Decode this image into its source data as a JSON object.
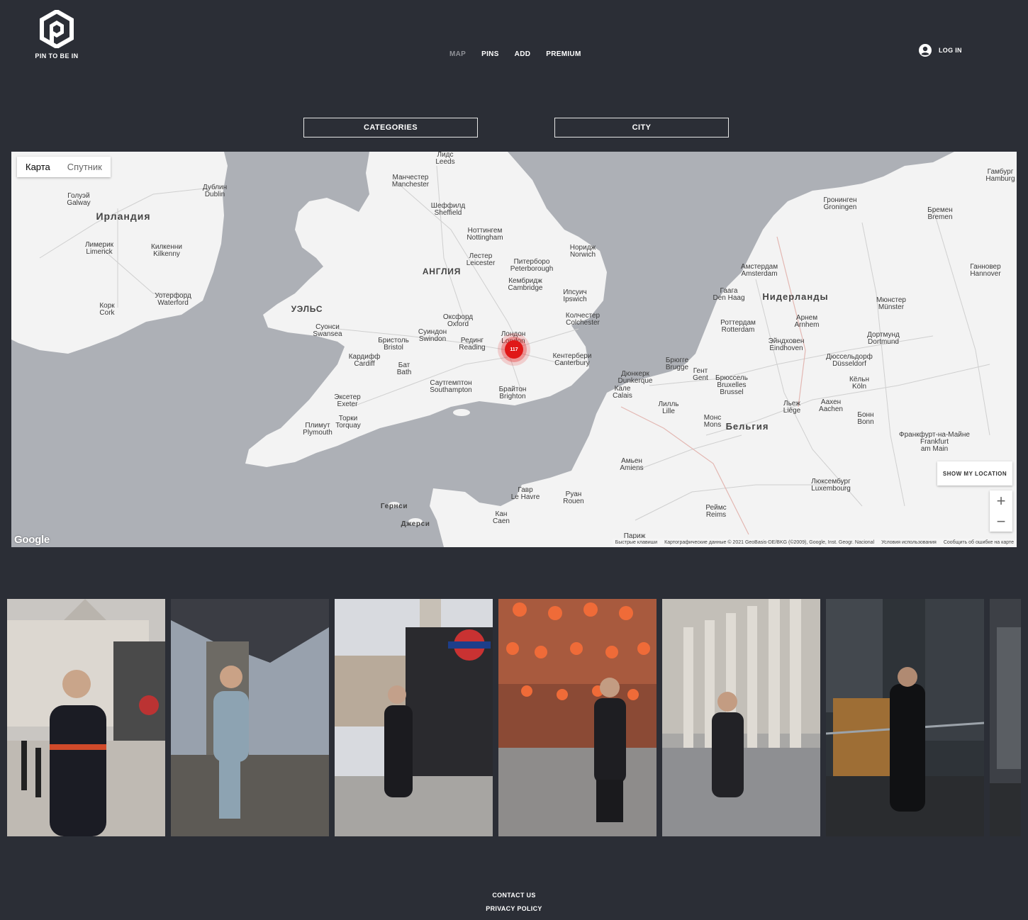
{
  "header": {
    "logo_text": "PIN TO BE IN",
    "nav": [
      "MAP",
      "PINS",
      "ADD",
      "PREMIUM"
    ],
    "login_label": "LOG IN"
  },
  "filters": {
    "categories_label": "CATEGORIES",
    "city_label": "CITY"
  },
  "map": {
    "type_map": "Карта",
    "type_satellite": "Спутник",
    "show_location": "SHOW MY LOCATION",
    "zoom_in": "+",
    "zoom_out": "−",
    "google_logo": "Google",
    "cluster_count": "117",
    "attribution": [
      "Быстрые клавиши",
      "Картографические данные © 2021 GeoBasis-DE/BKG (©2009), Google, Inst. Geogr. Nacional",
      "Условия использования",
      "Сообщить об ошибке на карте"
    ],
    "labels": {
      "ireland": "Ирландия",
      "england": "АНГЛИЯ",
      "wales": "УЭЛЬС",
      "netherlands": "Нидерланды",
      "belgium": "Бельгия",
      "guernsey": "Гернси",
      "jersey": "Джерси",
      "dublin": "Дублин\nDublin",
      "limerick": "Лимерик\nLimerick",
      "cork": "Корк\nCork",
      "galway": "Голуэй\nGalway",
      "kilkenny": "Килкенни\nKilkenny",
      "waterford": "Уотерфорд\nWaterford",
      "manchester": "Манчестер\nManchester",
      "leeds": "Лидс\nLeeds",
      "sheffield": "Шеффилд\nSheffield",
      "nottingham": "Ноттингем\nNottingham",
      "leicester": "Лестер\nLeicester",
      "peterborough": "Питерборо\nPeterborough",
      "cambridge": "Кембридж\nCambridge",
      "norwich": "Норидж\nNorwich",
      "ipswich": "Ипсуич\nIpswich",
      "colchester": "Колчестер\nColchester",
      "oxford": "Оксфорд\nOxford",
      "london": "Лондон\nLondon",
      "reading": "Рединг\nReading",
      "swindon": "Суиндон\nSwindon",
      "bristol": "Бристоль\nBristol",
      "cardiff": "Кардифф\nCardiff",
      "swansea": "Суонси\nSwansea",
      "bath": "Бат\nBath",
      "southampton": "Саутгемптон\nSouthampton",
      "brighton": "Брайтон\nBrighton",
      "exeter": "Эксетер\nExeter",
      "plymouth": "Плимут\nPlymouth",
      "torquay": "Торки\nTorquay",
      "canterbury": "Кентербери\nCanterbury",
      "amsterdam": "Амстердам\nAmsterdam",
      "den_haag": "Гаага\nDen Haag",
      "rotterdam": "Роттердам\nRotterdam",
      "brussels": "Брюссель\nBruxelles\nBrussel",
      "gent": "Гент\nGent",
      "brugge": "Брюгге\nBrugge",
      "lille": "Лилль\nLille",
      "dunkerque": "Дюнкерк\nDunkerque",
      "calais": "Кале\nCalais",
      "eindhoven": "Эйндховен\nEindhoven",
      "arnhem": "Арнем\nArnhem",
      "dusseldorf": "Дюссельдорф\nDüsseldorf",
      "koln": "Кёльн\nKöln",
      "bonn": "Бонн\nBonn",
      "dortmund": "Дортмунд\nDortmund",
      "munster": "Мюнстер\nMünster",
      "bremen": "Бремен\nBremen",
      "hamburg": "Гамбург\nHamburg",
      "hannover": "Ганновер\nHannover",
      "frankfurt": "Франкфурт-на-Майне\nFrankfurt\nam Main",
      "luxembourg": "Люксембург\nLuxembourg",
      "amiens": "Амьен\nAmiens",
      "rouen": "Руан\nRouen",
      "le_havre": "Гавр\nLe Havre",
      "caen": "Кан\nCaen",
      "paris": "Париж",
      "reims": "Реймс\nReims",
      "groningen": "Гронинген\nGroningen",
      "liege": "Льеж\nLiège",
      "mons": "Монс\nMons",
      "aachen": "Аахен\nAachen"
    }
  },
  "gallery": {
    "photos": [
      {
        "alt": "man-at-horse-guards"
      },
      {
        "alt": "man-at-tower-bridge"
      },
      {
        "alt": "man-at-charing-cross-underground"
      },
      {
        "alt": "man-in-chinatown"
      },
      {
        "alt": "man-on-columned-building-steps"
      },
      {
        "alt": "man-in-lloyds-building"
      },
      {
        "alt": "partial-photo"
      }
    ]
  },
  "footer": {
    "contact": "CONTACT US",
    "privacy": "PRIVACY POLICY"
  }
}
